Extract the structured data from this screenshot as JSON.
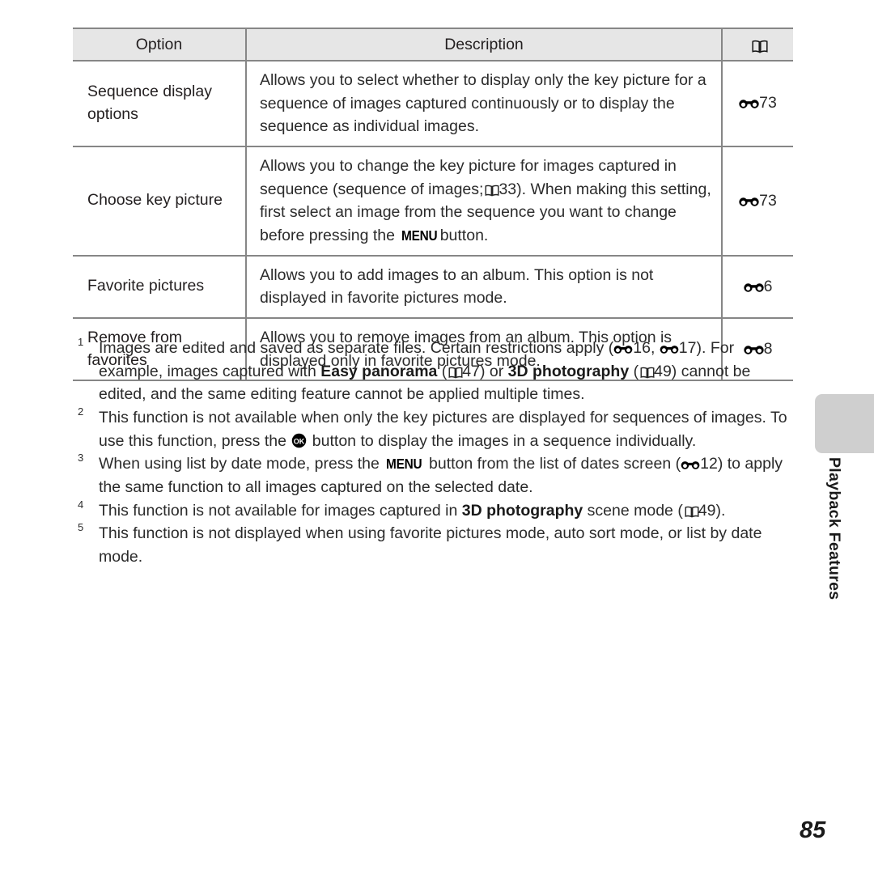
{
  "page": {
    "number": "85",
    "side_tab_label": "Playback Features"
  },
  "table": {
    "headers": {
      "option": "Option",
      "description": "Description",
      "reference": "book-icon"
    },
    "rows": [
      {
        "option": "Sequence display options",
        "description_lines": [
          "Allows you to select whether to display only the key picture for a",
          "sequence of images captured continuously or to display the",
          "sequence as individual images."
        ],
        "reference": "73",
        "reference_icon": "reference-binocular-icon"
      },
      {
        "option": "Choose key picture",
        "description_lines": [
          "Allows you to change the key picture for images captured in",
          "sequence (sequence of images;  33).",
          "When making this setting, first select an image from the",
          "sequence you want to change before pressing the MENU button."
        ],
        "reference": "73",
        "reference_icon": "reference-binocular-icon"
      },
      {
        "option": "Favorite pictures",
        "description_lines": [
          "Allows you to add images to an album.",
          "This option is not displayed in favorite pictures mode."
        ],
        "reference": "6",
        "reference_icon": "reference-binocular-icon"
      },
      {
        "option": "Remove from favorites",
        "description_lines": [
          "Allows you to remove images from an album.",
          "This option is displayed only in favorite pictures mode."
        ],
        "reference": "8",
        "reference_icon": "reference-binocular-icon"
      }
    ]
  },
  "row_text": {
    "r1_option": "Sequence display options",
    "r1_ref": "73",
    "r2_option": "Choose key picture",
    "r2_d1": "Allows you to change the key picture for images captured in",
    "r2_d2a": "sequence (sequence of images;",
    "r2_d2b": "33).",
    "r2_d3": "When making this setting, first select an image from the",
    "r2_d4a": "sequence you want to change before pressing the",
    "r2_d4b": "button.",
    "r2_menu": "MENU",
    "r2_ref": "73",
    "r3_option": "Favorite pictures",
    "r3_d1": "Allows you to add images to an album.",
    "r3_d2": "This option is not displayed in favorite pictures mode.",
    "r3_ref": "6",
    "r4_option": "Remove from favorites",
    "r4_d1": "Allows you to remove images from an album.",
    "r4_d2": "This option is displayed only in favorite pictures mode.",
    "r4_ref": "8"
  },
  "r1_desc": {
    "l1": "Allows you to select whether to display only the key picture for a",
    "l2": "sequence of images captured continuously or to display the",
    "l3": "sequence as individual images."
  },
  "footnotes": [
    {
      "num": "1",
      "parts": {
        "a": "Images are edited and saved as separate files. Certain restrictions apply (",
        "ref1": "16",
        "sep": ", ",
        "ref2": "17",
        "b": "). For example, images captured with ",
        "bold1": "Easy panorama",
        "c": " (",
        "page1": "47",
        "d": ") or ",
        "bold2": "3D photography",
        "e": " (",
        "page2": "49",
        "f": ") cannot be edited, and the same editing feature cannot be applied multiple times."
      }
    },
    {
      "num": "2",
      "parts": {
        "a": "This function is not available when only the key pictures are displayed for sequences of images. To use this function, press the ",
        "b": " button to display the images in a sequence individually."
      }
    },
    {
      "num": "3",
      "parts": {
        "a": "When using list by date mode, press the ",
        "menu": "MENU",
        "b": " button from the list of dates screen (",
        "ref": "12",
        "c": ") to apply the same function to all images captured on the selected date."
      }
    },
    {
      "num": "4",
      "parts": {
        "a": "This function is not available for images captured in ",
        "bold": "3D photography",
        "b": " scene mode (",
        "page": "49",
        "c": ")."
      }
    },
    {
      "num": "5",
      "parts": {
        "a": "This function is not displayed when using favorite pictures mode, auto sort mode, or list by date mode."
      }
    }
  ],
  "colors": {
    "header_bg": "#e6e6e6",
    "border": "#868686",
    "tab_grey": "#cfcfcf",
    "text": "#231f20"
  }
}
